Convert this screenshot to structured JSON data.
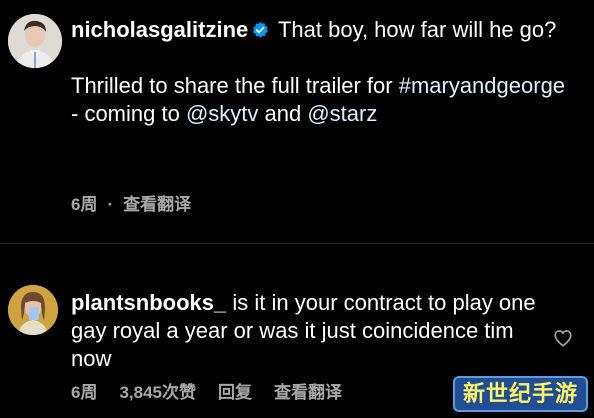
{
  "post": {
    "username": "nicholasgalitzine",
    "verified_icon": "verified-badge-icon",
    "text_line1": "That boy, how far will he go?",
    "text_line2_part1": "Thrilled to share the full trailer for",
    "hashtag": "#maryandgeorge",
    "text_line2_part2": " - coming to ",
    "mention1": "@skytv",
    "text_line2_part3": " and",
    "mention2": "@starz",
    "age": "6周",
    "separator": "·",
    "translate": "查看翻译"
  },
  "reply": {
    "username": "plantsnbooks_",
    "text": "is it in your contract to play one gay royal a year or was it just coincidence tim now",
    "age": "6周",
    "likes": "3,845次赞",
    "reply_label": "回复",
    "translate": "查看翻译",
    "like_icon": "heart-icon"
  },
  "watermark": {
    "text": "新世纪手游"
  },
  "colors": {
    "background": "#000000",
    "text": "#ffffff",
    "meta": "#a8a8a8",
    "verified": "#0095f6",
    "divider": "#262626"
  }
}
